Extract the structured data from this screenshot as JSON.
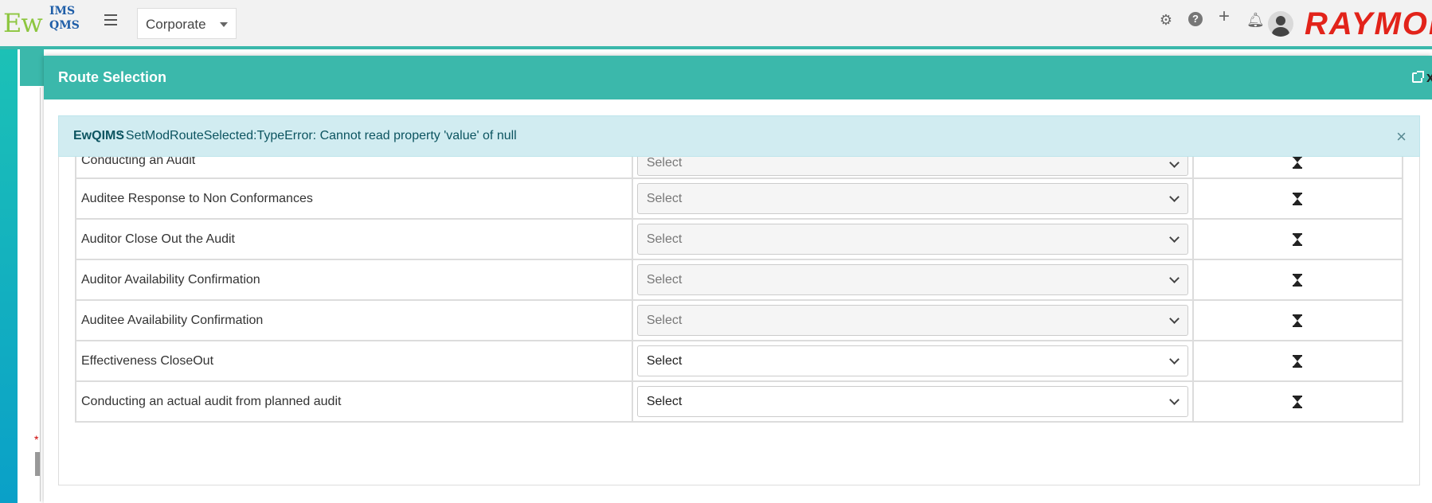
{
  "app": {
    "logo_ew": "Ew",
    "logo_ims": "IMS",
    "logo_qms": "QMS",
    "org_selected": "Corporate",
    "brand": "RAYMOI"
  },
  "icons": [
    "menu-icon",
    "settings-gear-icon",
    "help-icon",
    "add-plus-icon",
    "notification-bell-icon",
    "user-avatar",
    "external-link-icon",
    "close-icon",
    "hourglass-icon"
  ],
  "colors": {
    "accent": "#3bb8ab",
    "alert_bg": "#d1ecf1",
    "alert_text": "#0c5460",
    "brand_red": "#e2231a"
  },
  "modal": {
    "title": "Route Selection",
    "close_label": "x",
    "alert": {
      "title": "EwQIMS",
      "message": ": SetModRouteSelected:TypeError: Cannot read property 'value' of null",
      "close": "×"
    },
    "rows": [
      {
        "step": "Conducting an Audit",
        "route": "Select",
        "enabled": false
      },
      {
        "step": "Auditee Response to Non Conformances",
        "route": "Select",
        "enabled": false
      },
      {
        "step": "Auditor Close Out the Audit",
        "route": "Select",
        "enabled": false
      },
      {
        "step": "Auditor Availability Confirmation",
        "route": "Select",
        "enabled": false
      },
      {
        "step": "Auditee Availability Confirmation",
        "route": "Select",
        "enabled": false
      },
      {
        "step": "Effectiveness CloseOut",
        "route": "Select",
        "enabled": true
      },
      {
        "step": "Conducting an actual audit from planned audit",
        "route": "Select",
        "enabled": true
      }
    ]
  },
  "background": {
    "required_marker": "*"
  }
}
